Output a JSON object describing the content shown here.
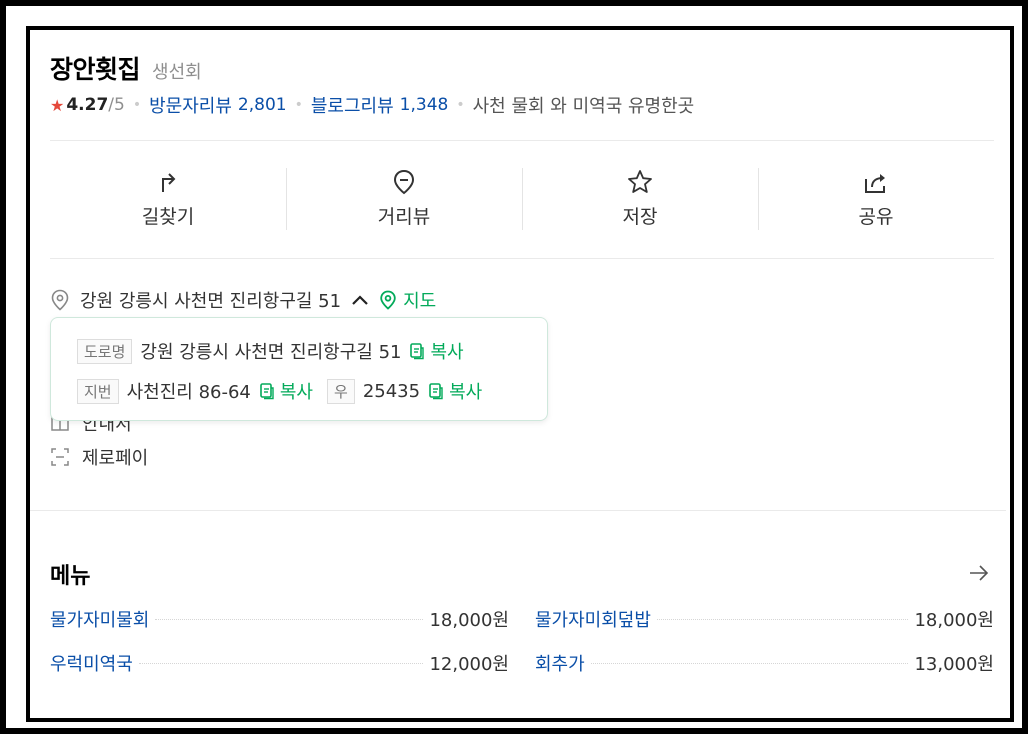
{
  "place": {
    "name": "장안횟집",
    "category": "생선회",
    "rating": "4.27",
    "rating_max": "/5",
    "visitor_reviews_label": "방문자리뷰",
    "visitor_reviews_count": "2,801",
    "blog_reviews_label": "블로그리뷰",
    "blog_reviews_count": "1,348",
    "tagline": "사천 물회 와 미역국 유명한곳"
  },
  "actions": [
    {
      "label": "길찾기",
      "icon": "directions-icon"
    },
    {
      "label": "거리뷰",
      "icon": "location-pin-icon"
    },
    {
      "label": "저장",
      "icon": "star-icon"
    },
    {
      "label": "공유",
      "icon": "share-icon"
    }
  ],
  "address": {
    "text": "강원 강릉시 사천면 진리항구길 51",
    "map_label": "지도",
    "popup": {
      "road_tag": "도로명",
      "road_address": "강원 강릉시 사천면 진리항구길 51",
      "jibun_tag": "지번",
      "jibun_address": "사천진리 86-64",
      "zip_tag": "우",
      "zip_code": "25435",
      "copy_label": "복사"
    }
  },
  "hidden_rows": {
    "partial_text": "안내서",
    "zeropay": "제로페이"
  },
  "menu": {
    "title": "메뉴",
    "items": [
      {
        "name": "물가자미물회",
        "price": "18,000원"
      },
      {
        "name": "물가자미회덮밥",
        "price": "18,000원"
      },
      {
        "name": "우럭미역국",
        "price": "12,000원"
      },
      {
        "name": "회추가",
        "price": "13,000원"
      }
    ]
  },
  "colors": {
    "accent_green": "#03aa5a",
    "link_blue": "#0b4fa8",
    "star_red": "#e5483a"
  }
}
